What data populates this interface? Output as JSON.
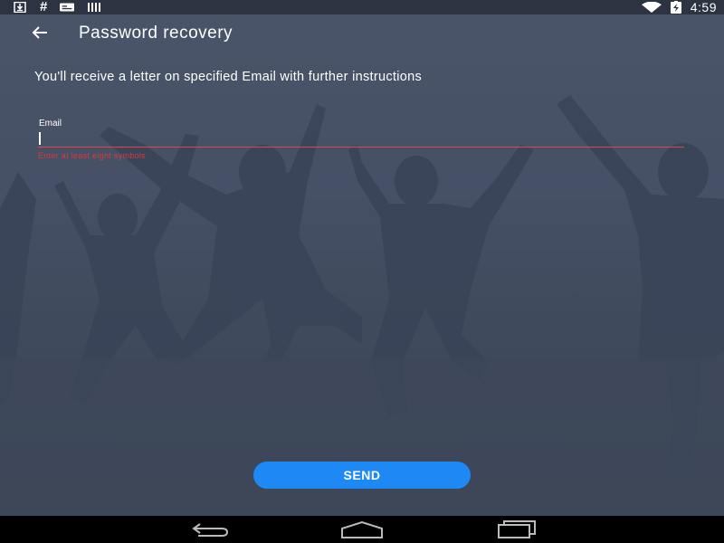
{
  "status_bar": {
    "icons": [
      "download-icon",
      "hash-icon",
      "notification-card-icon",
      "barcode-icon"
    ],
    "right_icons": [
      "wifi-icon",
      "battery-charging-icon"
    ],
    "time": "4:59"
  },
  "appbar": {
    "back_icon": "arrow-left-icon",
    "title": "Password recovery"
  },
  "form": {
    "instructions": "You'll receive a letter on specified Email with further instructions",
    "email_label": "Email",
    "email_value": "",
    "error_text": "Enter at least eight symbols",
    "accent_color": "#e04646"
  },
  "send_button": {
    "label": "SEND",
    "color": "#1e88f5"
  },
  "nav_bar": {
    "buttons": [
      "back-nav-icon",
      "home-nav-icon",
      "recent-apps-icon"
    ]
  }
}
